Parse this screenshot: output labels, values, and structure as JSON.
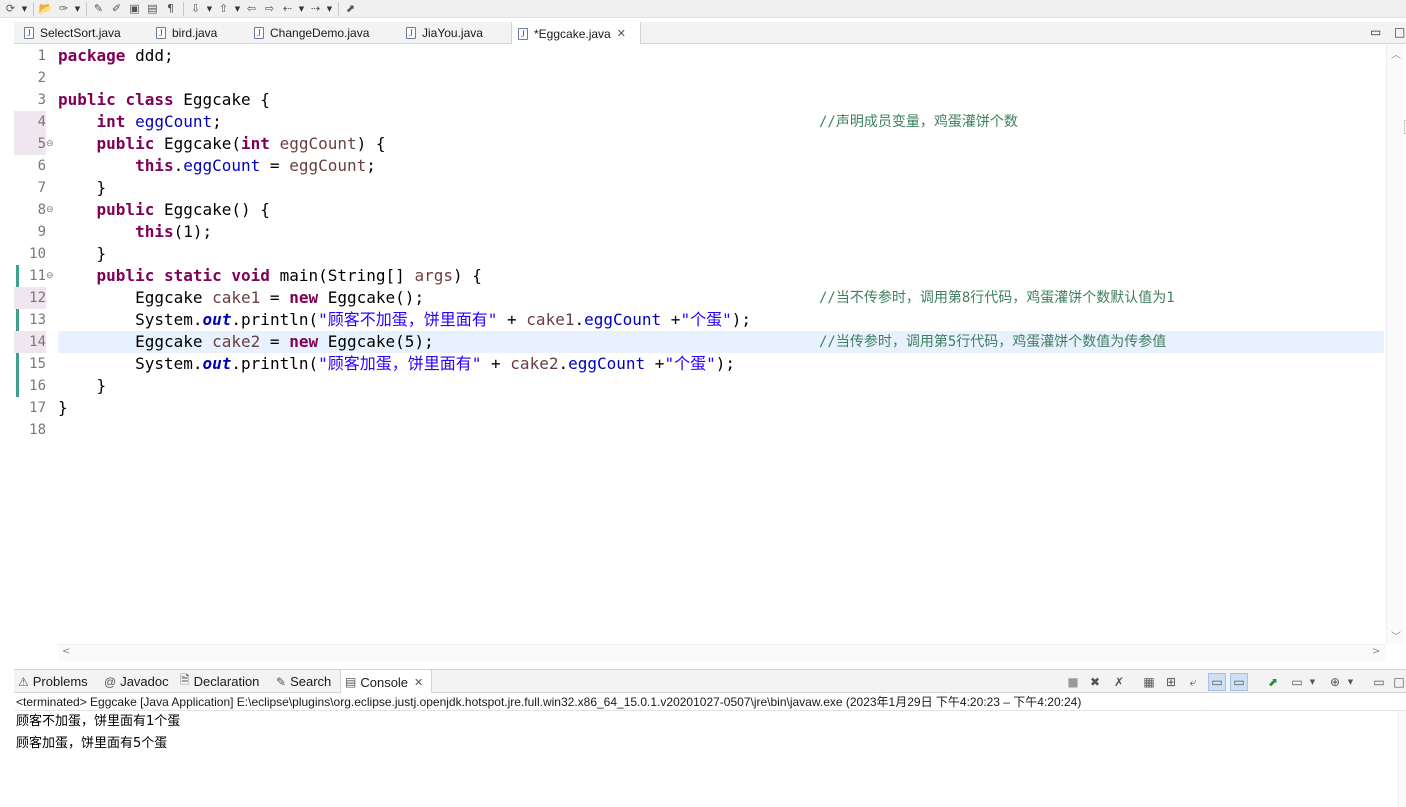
{
  "toolbar": {
    "icons": [
      "new-run-icon",
      "open-folder-icon",
      "toggle-breakpoint-icon",
      "mark-occurrences-icon",
      "annotation-icon",
      "show-whitespace-icon",
      "next-annotation-icon",
      "prev-annotation-icon",
      "last-edit-icon",
      "back-icon",
      "forward-icon",
      "pin-editor-icon"
    ]
  },
  "editor": {
    "tabs": [
      {
        "label": "SelectSort.java",
        "active": false
      },
      {
        "label": "bird.java",
        "active": false
      },
      {
        "label": "ChangeDemo.java",
        "active": false
      },
      {
        "label": "JiaYou.java",
        "active": false
      },
      {
        "label": "*Eggcake.java",
        "active": true
      }
    ],
    "tab_icon_glyph": "J",
    "close_glyph": "✕",
    "minimize_glyph": "▭",
    "maximize_glyph": "□",
    "line_numbers": [
      "1",
      "2",
      "3",
      "4",
      "5",
      "6",
      "7",
      "8",
      "9",
      "10",
      "11",
      "12",
      "13",
      "14",
      "15",
      "16",
      "17",
      "18"
    ],
    "fold_glyph": "⊖",
    "current_line": 14,
    "lines": [
      {
        "n": 1,
        "t": [
          {
            "c": "kw",
            "s": "package"
          },
          {
            "c": "",
            "s": " ddd;"
          }
        ]
      },
      {
        "n": 2,
        "t": []
      },
      {
        "n": 3,
        "t": [
          {
            "c": "kw",
            "s": "public"
          },
          {
            "c": "",
            "s": " "
          },
          {
            "c": "kw",
            "s": "class"
          },
          {
            "c": "",
            "s": " Eggcake {"
          }
        ]
      },
      {
        "n": 4,
        "t": [
          {
            "c": "",
            "s": "    "
          },
          {
            "c": "kw",
            "s": "int"
          },
          {
            "c": "",
            "s": " "
          },
          {
            "c": "fld",
            "s": "eggCount"
          },
          {
            "c": "",
            "s": ";"
          }
        ],
        "comment": "//声明成员变量，鸡蛋灌饼个数"
      },
      {
        "n": 5,
        "t": [
          {
            "c": "",
            "s": "    "
          },
          {
            "c": "kw",
            "s": "public"
          },
          {
            "c": "",
            "s": " Eggcake("
          },
          {
            "c": "kw",
            "s": "int"
          },
          {
            "c": "",
            "s": " "
          },
          {
            "c": "var",
            "s": "eggCount"
          },
          {
            "c": "",
            "s": ") {"
          }
        ]
      },
      {
        "n": 6,
        "t": [
          {
            "c": "",
            "s": "        "
          },
          {
            "c": "kw",
            "s": "this"
          },
          {
            "c": "",
            "s": "."
          },
          {
            "c": "fld",
            "s": "eggCount"
          },
          {
            "c": "",
            "s": " = "
          },
          {
            "c": "var",
            "s": "eggCount"
          },
          {
            "c": "",
            "s": ";"
          }
        ]
      },
      {
        "n": 7,
        "t": [
          {
            "c": "",
            "s": "    }"
          }
        ]
      },
      {
        "n": 8,
        "t": [
          {
            "c": "",
            "s": "    "
          },
          {
            "c": "kw",
            "s": "public"
          },
          {
            "c": "",
            "s": " Eggcake() {"
          }
        ]
      },
      {
        "n": 9,
        "t": [
          {
            "c": "",
            "s": "        "
          },
          {
            "c": "kw",
            "s": "this"
          },
          {
            "c": "",
            "s": "(1);"
          }
        ]
      },
      {
        "n": 10,
        "t": [
          {
            "c": "",
            "s": "    }"
          }
        ]
      },
      {
        "n": 11,
        "t": [
          {
            "c": "",
            "s": "    "
          },
          {
            "c": "kw",
            "s": "public"
          },
          {
            "c": "",
            "s": " "
          },
          {
            "c": "kw",
            "s": "static"
          },
          {
            "c": "",
            "s": " "
          },
          {
            "c": "kw",
            "s": "void"
          },
          {
            "c": "",
            "s": " main(String[] "
          },
          {
            "c": "var",
            "s": "args"
          },
          {
            "c": "",
            "s": ") {"
          }
        ]
      },
      {
        "n": 12,
        "t": [
          {
            "c": "",
            "s": "        Eggcake "
          },
          {
            "c": "var",
            "s": "cake1"
          },
          {
            "c": "",
            "s": " = "
          },
          {
            "c": "kw",
            "s": "new"
          },
          {
            "c": "",
            "s": " Eggcake();"
          }
        ],
        "comment": "//当不传参时，调用第8行代码，鸡蛋灌饼个数默认值为1"
      },
      {
        "n": 13,
        "t": [
          {
            "c": "",
            "s": "        System."
          },
          {
            "c": "stf",
            "s": "out"
          },
          {
            "c": "",
            "s": ".println("
          },
          {
            "c": "str",
            "s": "\"顾客不加蛋，饼里面有\""
          },
          {
            "c": "",
            "s": " + "
          },
          {
            "c": "var",
            "s": "cake1"
          },
          {
            "c": "",
            "s": "."
          },
          {
            "c": "fld",
            "s": "eggCount"
          },
          {
            "c": "",
            "s": " +"
          },
          {
            "c": "str",
            "s": "\"个蛋\""
          },
          {
            "c": "",
            "s": ");"
          }
        ]
      },
      {
        "n": 14,
        "t": [
          {
            "c": "",
            "s": "        Eggcake "
          },
          {
            "c": "var",
            "s": "cake2"
          },
          {
            "c": "",
            "s": " = "
          },
          {
            "c": "kw",
            "s": "new"
          },
          {
            "c": "",
            "s": " Eggcake(5);"
          }
        ],
        "comment": "//当传参时，调用第5行代码，鸡蛋灌饼个数值为传参值"
      },
      {
        "n": 15,
        "t": [
          {
            "c": "",
            "s": "        System."
          },
          {
            "c": "stf",
            "s": "out"
          },
          {
            "c": "",
            "s": ".println("
          },
          {
            "c": "str",
            "s": "\"顾客加蛋，饼里面有\""
          },
          {
            "c": "",
            "s": " + "
          },
          {
            "c": "var",
            "s": "cake2"
          },
          {
            "c": "",
            "s": "."
          },
          {
            "c": "fld",
            "s": "eggCount"
          },
          {
            "c": "",
            "s": " +"
          },
          {
            "c": "str",
            "s": "\"个蛋\""
          },
          {
            "c": "",
            "s": ");"
          }
        ]
      },
      {
        "n": 16,
        "t": [
          {
            "c": "",
            "s": "    }"
          }
        ]
      },
      {
        "n": 17,
        "t": [
          {
            "c": "",
            "s": "}"
          }
        ]
      },
      {
        "n": 18,
        "t": []
      }
    ]
  },
  "console": {
    "tabs": [
      {
        "label": "Problems",
        "icon": "problems-icon",
        "glyph": "⚠",
        "active": false
      },
      {
        "label": "Javadoc",
        "icon": "javadoc-icon",
        "glyph": "@",
        "active": false
      },
      {
        "label": "Declaration",
        "icon": "declaration-icon",
        "glyph": "🗎",
        "active": false
      },
      {
        "label": "Search",
        "icon": "search-icon",
        "glyph": "✎",
        "active": false
      },
      {
        "label": "Console",
        "icon": "console-icon",
        "glyph": "▤",
        "active": true
      }
    ],
    "toolbar_icons": [
      "terminate-icon",
      "remove-launch-icon",
      "remove-all-terminated-icon",
      "clear-console-icon",
      "scroll-lock-icon",
      "word-wrap-icon",
      "show-on-stdout-icon",
      "show-on-stderr-icon",
      "pin-console-icon",
      "display-console-icon",
      "open-console-icon",
      "minimize-icon",
      "maximize-icon"
    ],
    "description": "<terminated> Eggcake [Java Application] E:\\eclipse\\plugins\\org.eclipse.justj.openjdk.hotspot.jre.full.win32.x86_64_15.0.1.v20201027-0507\\jre\\bin\\javaw.exe  (2023年1月29日 下午4:20:23 – 下午4:20:24)",
    "output": [
      "顾客不加蛋，饼里面有1个蛋",
      "顾客加蛋，饼里面有5个蛋"
    ]
  },
  "colors": {
    "keyword": "#7f0055",
    "field": "#0000c0",
    "local_variable": "#6a3e3e",
    "string": "#2a00ff",
    "comment": "#3f7f5f",
    "current_line_bg": "#e8f2fe",
    "quick_diff": "#3f9f8f"
  }
}
